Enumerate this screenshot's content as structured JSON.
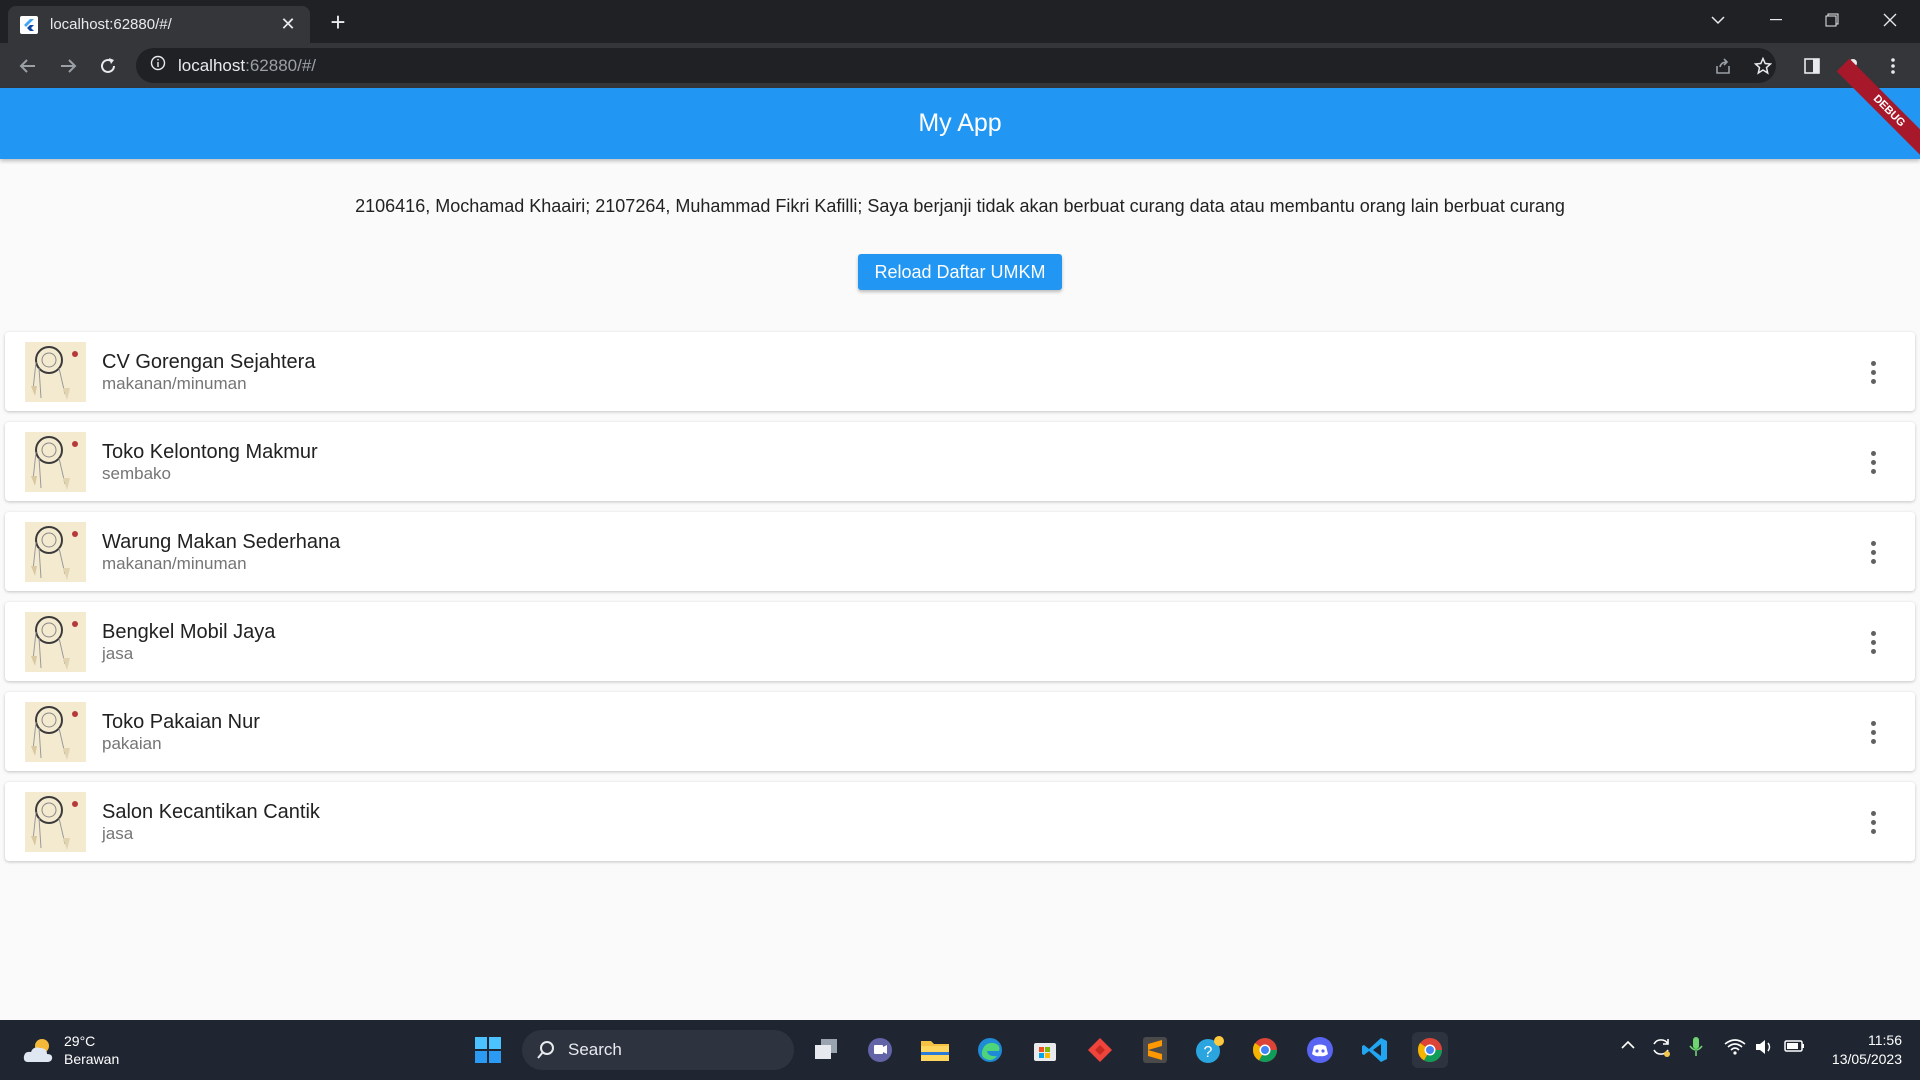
{
  "browser": {
    "tab_title": "localhost:62880/#/",
    "url_host": "localhost",
    "url_path": ":62880/#/"
  },
  "app": {
    "title": "My App",
    "debug_banner": "DEBUG",
    "declaration": "2106416, Mochamad Khaairi; 2107264, Muhammad Fikri Kafilli; Saya berjanji tidak akan berbuat curang data atau membantu orang lain berbuat curang",
    "reload_label": "Reload Daftar UMKM",
    "items": [
      {
        "name": "CV Gorengan Sejahtera",
        "type": "makanan/minuman"
      },
      {
        "name": "Toko Kelontong Makmur",
        "type": "sembako"
      },
      {
        "name": "Warung Makan Sederhana",
        "type": "makanan/minuman"
      },
      {
        "name": "Bengkel Mobil Jaya",
        "type": "jasa"
      },
      {
        "name": "Toko Pakaian Nur",
        "type": "pakaian"
      },
      {
        "name": "Salon Kecantikan Cantik",
        "type": "jasa"
      }
    ]
  },
  "taskbar": {
    "temperature": "29°C",
    "weather": "Berawan",
    "search_label": "Search",
    "time": "11:56",
    "date": "13/05/2023"
  },
  "colors": {
    "appbar": "#2196f3",
    "debug": "#a6182a",
    "taskbar": "#1f2631"
  }
}
